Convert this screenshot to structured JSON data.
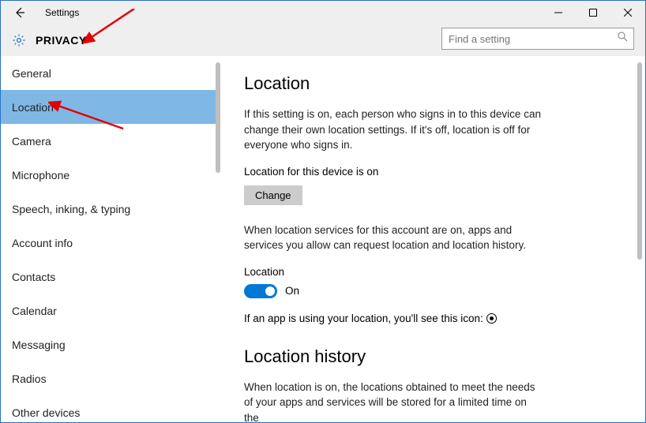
{
  "window": {
    "title": "Settings"
  },
  "header": {
    "title": "PRIVACY"
  },
  "search": {
    "placeholder": "Find a setting"
  },
  "sidebar": {
    "items": [
      {
        "label": "General",
        "active": false
      },
      {
        "label": "Location",
        "active": true
      },
      {
        "label": "Camera",
        "active": false
      },
      {
        "label": "Microphone",
        "active": false
      },
      {
        "label": "Speech, inking, & typing",
        "active": false
      },
      {
        "label": "Account info",
        "active": false
      },
      {
        "label": "Contacts",
        "active": false
      },
      {
        "label": "Calendar",
        "active": false
      },
      {
        "label": "Messaging",
        "active": false
      },
      {
        "label": "Radios",
        "active": false
      },
      {
        "label": "Other devices",
        "active": false
      }
    ]
  },
  "content": {
    "heading": "Location",
    "intro": "If this setting is on, each person who signs in to this device can change their own location settings. If it's off, location is off for everyone who signs in.",
    "device_status": "Location for this device is on",
    "change_button": "Change",
    "account_desc": "When location services for this account are on, apps and services you allow can request location and location history.",
    "toggle_label": "Location",
    "toggle_state": "On",
    "icon_line": "If an app is using your location, you'll see this icon:",
    "history_heading": "Location history",
    "history_desc": "When location is on, the locations obtained to meet the needs of your apps and services will be stored for a limited time on the"
  }
}
